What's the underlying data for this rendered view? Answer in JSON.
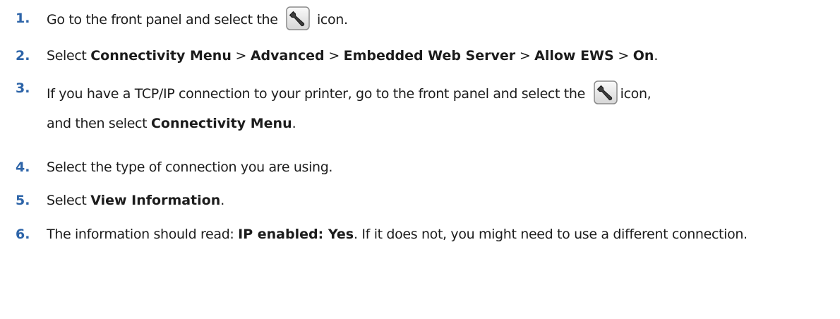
{
  "steps": [
    {
      "number": "1.",
      "t1": "Go to the front panel and select the",
      "t2": "icon.",
      "icon": "wrench-icon"
    },
    {
      "number": "2.",
      "t1": "Select",
      "b1": "Connectivity Menu",
      "sep1": ">",
      "b2": "Advanced",
      "sep2": ">",
      "b3": "Embedded Web Server",
      "sep3": ">",
      "b4": "Allow EWS",
      "sep4": ">",
      "b5": "On",
      "end": "."
    },
    {
      "number": "3.",
      "t1": "If you have a TCP/IP connection to your printer, go to the front panel and select the",
      "t2": "icon,",
      "t3": "and then select",
      "b1": "Connectivity Menu",
      "end": ".",
      "icon": "wrench-icon"
    },
    {
      "number": "4.",
      "t1": "Select the type of connection you are using."
    },
    {
      "number": "5.",
      "t1": "Select",
      "b1": "View Information",
      "end": "."
    },
    {
      "number": "6.",
      "t1": "The information should read:",
      "b1": "IP enabled: Yes",
      "t2": ". If it does not, you might need to use a different connection."
    }
  ]
}
